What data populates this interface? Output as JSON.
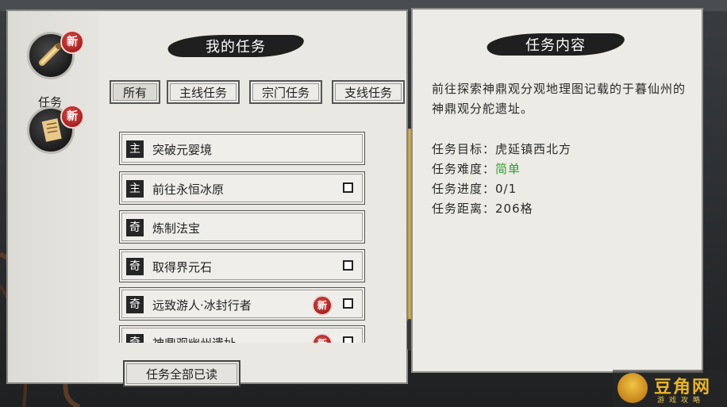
{
  "sidebar": {
    "task_label": "任务",
    "badge_new": "新"
  },
  "task_list": {
    "title": "我的任务",
    "tabs": [
      "所有",
      "主线任务",
      "宗门任务",
      "支线任务"
    ],
    "tasks": [
      {
        "tag": "主",
        "name": "突破元婴境",
        "checkbox": false,
        "is_new": false
      },
      {
        "tag": "主",
        "name": "前往永恒冰原",
        "checkbox": true,
        "is_new": false
      },
      {
        "tag": "奇",
        "name": "炼制法宝",
        "checkbox": false,
        "is_new": false
      },
      {
        "tag": "奇",
        "name": "取得界元石",
        "checkbox": true,
        "is_new": false
      },
      {
        "tag": "奇",
        "name": "远致游人·冰封行者",
        "checkbox": true,
        "is_new": true,
        "new_label": "新"
      },
      {
        "tag": "奇",
        "name": "神鼎观幽州遗址",
        "checkbox": true,
        "is_new": true,
        "new_label": "新"
      }
    ],
    "read_all_label": "任务全部已读"
  },
  "details": {
    "title": "任务内容",
    "description": "前往探索神鼎观分观地理图记载的于暮仙州的神鼎观分舵遗址。",
    "objective": "任务目标：虎延镇西北方",
    "difficulty_label": "任务难度：",
    "difficulty_value": "简单",
    "progress": "任务进度：0/1",
    "distance": "任务距离：206格"
  },
  "watermark": {
    "text": "豆角网",
    "sub": "游戏攻略"
  },
  "colors": {
    "easy": "#2f9e2f",
    "badge": "#a11d1d",
    "scrollbar": "#d5b564"
  }
}
